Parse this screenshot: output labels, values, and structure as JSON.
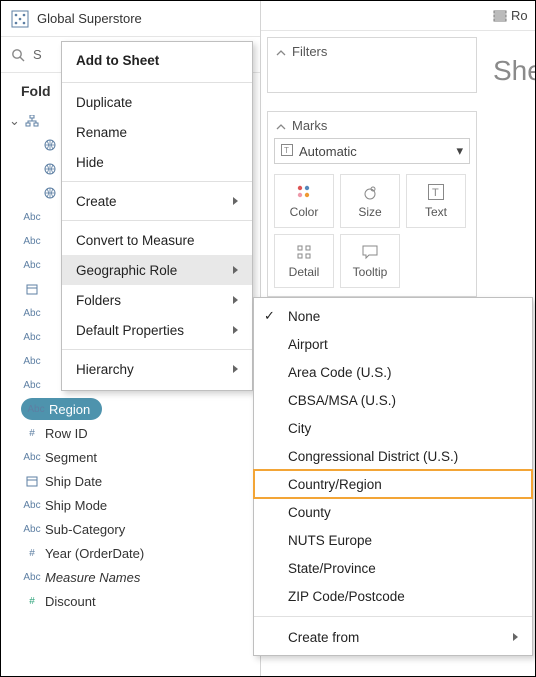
{
  "datasource": {
    "title": "Global Superstore"
  },
  "search": {
    "placeholder": "S"
  },
  "folders_label": "Fold",
  "fields": [
    {
      "icon": "hier",
      "label": "",
      "indent": 0
    },
    {
      "icon": "globe",
      "label": "",
      "indent": 1
    },
    {
      "icon": "globe",
      "label": "",
      "indent": 1
    },
    {
      "icon": "globe",
      "label": "",
      "indent": 1
    },
    {
      "icon": "abc",
      "label": "",
      "indent": 0
    },
    {
      "icon": "abc",
      "label": "",
      "indent": 0
    },
    {
      "icon": "abc",
      "label": "",
      "indent": 0
    },
    {
      "icon": "date",
      "label": "",
      "indent": 0
    },
    {
      "icon": "abc",
      "label": "",
      "indent": 0
    },
    {
      "icon": "abc",
      "label": "",
      "indent": 0
    },
    {
      "icon": "abc",
      "label": "",
      "indent": 0
    },
    {
      "icon": "abc",
      "label": "",
      "indent": 0
    },
    {
      "icon": "abc",
      "label": "Region",
      "indent": 0,
      "selected": true
    },
    {
      "icon": "hash",
      "label": "Row ID",
      "indent": 0
    },
    {
      "icon": "abc",
      "label": "Segment",
      "indent": 0
    },
    {
      "icon": "date",
      "label": "Ship Date",
      "indent": 0
    },
    {
      "icon": "abc",
      "label": "Ship Mode",
      "indent": 0
    },
    {
      "icon": "abc",
      "label": "Sub-Category",
      "indent": 0
    },
    {
      "icon": "hash",
      "label": "Year (OrderDate)",
      "indent": 0
    },
    {
      "icon": "abc",
      "label": "Measure Names",
      "indent": 0,
      "italic": true
    },
    {
      "icon": "hash-g",
      "label": "Discount",
      "indent": 0
    }
  ],
  "rows_label": "Ro",
  "sheet_label": "She",
  "filters": {
    "title": "Filters"
  },
  "marks": {
    "title": "Marks",
    "auto_label": "Automatic",
    "buttons": {
      "color": "Color",
      "size": "Size",
      "text": "Text",
      "detail": "Detail",
      "tooltip": "Tooltip"
    }
  },
  "ctx": {
    "add": "Add to Sheet",
    "duplicate": "Duplicate",
    "rename": "Rename",
    "hide": "Hide",
    "create": "Create",
    "convert": "Convert to Measure",
    "geo": "Geographic Role",
    "folders": "Folders",
    "defaults": "Default Properties",
    "hierarchy": "Hierarchy"
  },
  "geo_roles": {
    "none": "None",
    "airport": "Airport",
    "area": "Area Code (U.S.)",
    "cbsa": "CBSA/MSA (U.S.)",
    "city": "City",
    "cong": "Congressional District (U.S.)",
    "country": "Country/Region",
    "county": "County",
    "nuts": "NUTS Europe",
    "state": "State/Province",
    "zip": "ZIP Code/Postcode",
    "create_from": "Create from"
  }
}
